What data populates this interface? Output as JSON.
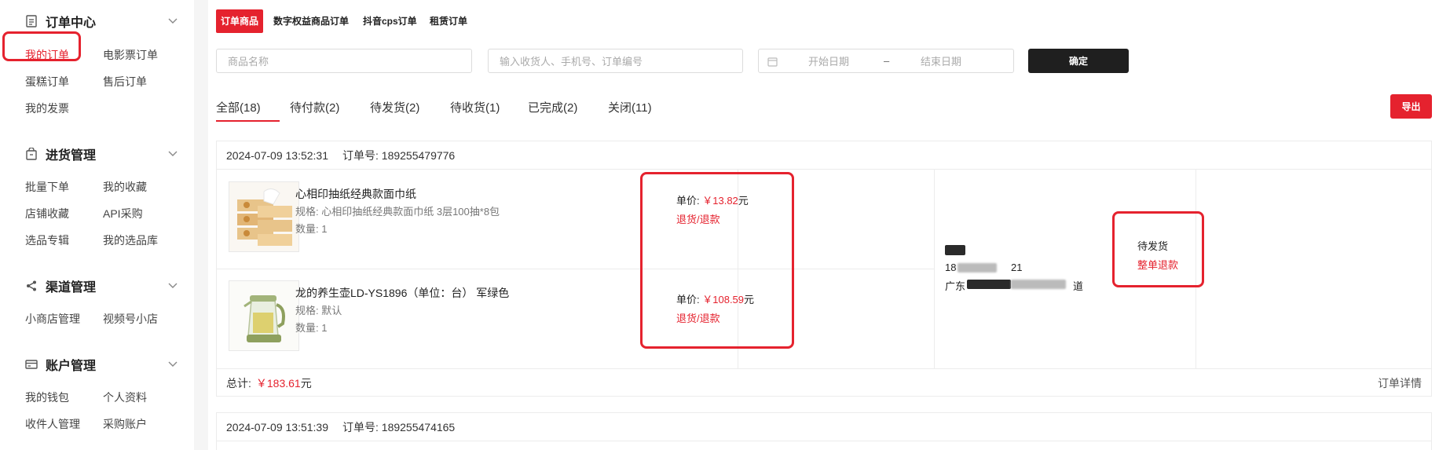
{
  "sidebar": {
    "sections": [
      {
        "icon": "document-icon",
        "title": "订单中心",
        "links": [
          "我的订单",
          "电影票订单",
          "蛋糕订单",
          "售后订单",
          "我的发票"
        ]
      },
      {
        "icon": "bag-icon",
        "title": "进货管理",
        "links": [
          "批量下单",
          "我的收藏",
          "店铺收藏",
          "API采购",
          "选品专辑",
          "我的选品库"
        ]
      },
      {
        "icon": "share-icon",
        "title": "渠道管理",
        "links": [
          "小商店管理",
          "视频号小店"
        ]
      },
      {
        "icon": "card-icon",
        "title": "账户管理",
        "links": [
          "我的钱包",
          "个人资料",
          "收件人管理",
          "采购账户"
        ]
      }
    ]
  },
  "type_tabs": [
    "订单商品",
    "数字权益商品订单",
    "抖音cps订单",
    "租赁订单"
  ],
  "filters": {
    "product_placeholder": "商品名称",
    "search_placeholder": "输入收货人、手机号、订单编号",
    "start_date": "开始日期",
    "date_sep": "–",
    "end_date": "结束日期",
    "confirm": "确定"
  },
  "status_tabs": [
    "全部(18)",
    "待付款(2)",
    "待发货(2)",
    "待收货(1)",
    "已完成(2)",
    "关闭(11)"
  ],
  "export_label": "导出",
  "orders": [
    {
      "date": "2024-07-09 13:52:31",
      "order_no": "订单号: 189255479776",
      "items": [
        {
          "name": "心相印抽纸经典款面巾纸",
          "spec": "规格: 心相印抽纸经典款面巾纸 3层100抽*8包",
          "qty": "数量: 1",
          "price_label": "单价:",
          "price": "￥13.82",
          "unit": "元",
          "refund": "退货/退款"
        },
        {
          "name": "龙的养生壶LD-YS1896（单位：台） 军绿色",
          "spec": "规格: 默认",
          "qty": "数量: 1",
          "price_label": "单价:",
          "price": "￥108.59",
          "unit": "元",
          "refund": "退货/退款"
        }
      ],
      "address": {
        "line1": "18",
        "line1_suffix": "21",
        "line2_prefix": "广东",
        "line2_suffix": "道"
      },
      "status": "待发货",
      "whole_refund": "整单退款",
      "total_label": "总计:",
      "total_value": "￥183.61",
      "total_unit": "元",
      "detail": "订单详情"
    },
    {
      "date": "2024-07-09 13:51:39",
      "order_no": "订单号: 189255474165"
    }
  ],
  "colors": {
    "accent": "#e5222e",
    "confirm_bg": "#1f1f1f"
  }
}
